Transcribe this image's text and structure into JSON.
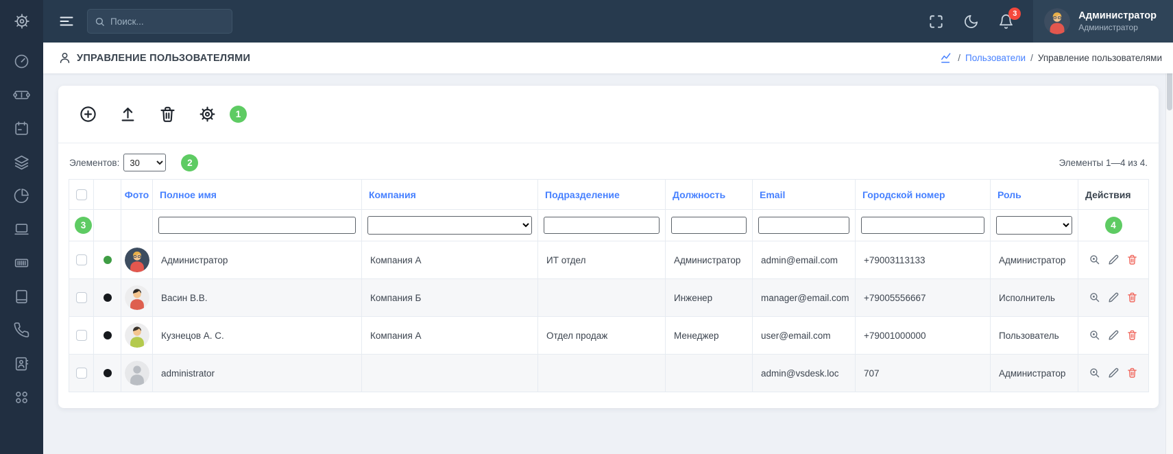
{
  "colors": {
    "accent_blue": "#4680ff",
    "badge_green": "#5ecb63",
    "notification_red": "#f4483c",
    "delete_red": "#f0695f",
    "status_online": "#3f9d44",
    "status_offline": "#16191d"
  },
  "sidebar": {
    "items": [
      "settings",
      "dashboard",
      "tickets",
      "calendar",
      "layers",
      "reports",
      "monitoring",
      "barcode",
      "knowledge-base",
      "telephony",
      "contacts",
      "apps"
    ]
  },
  "topbar": {
    "search_placeholder": "Поиск...",
    "notification_count": "3",
    "user_name": "Администратор",
    "user_role": "Администратор",
    "avatar": {
      "bg": "#3d4d60",
      "skin": "#f4c58f",
      "hair": "#e9b04a",
      "shirt": "#e3574e"
    }
  },
  "page": {
    "title": "УПРАВЛЕНИЕ ПОЛЬЗОВАТЕЛЯМИ",
    "breadcrumb": {
      "sep": "/",
      "link": "Пользователи",
      "current": "Управление пользователями"
    }
  },
  "toolbar": {
    "hint_badge": "1"
  },
  "list_controls": {
    "items_label": "Элементов:",
    "items_per_page": "30",
    "hint_badge": "2",
    "range_text": "Элементы 1—4 из 4."
  },
  "table": {
    "columns": {
      "photo": "Фото",
      "full_name": "Полное имя",
      "company": "Компания",
      "department": "Подразделение",
      "position": "Должность",
      "email": "Email",
      "phone": "Городской номер",
      "role": "Роль",
      "actions": "Действия"
    },
    "filter_hint_badge": "3",
    "actions_hint_badge": "4",
    "rows": [
      {
        "status_color": "#3f9d44",
        "full_name": "Администратор",
        "company": "Компания А",
        "department": "ИТ отдел",
        "position": "Администратор",
        "email": "admin@email.com",
        "phone": "+79003113133",
        "role": "Администратор",
        "avatar": {
          "bg": "#3d4d60",
          "skin": "#f4c58f",
          "hair": "#e9b04a",
          "shirt": "#e3574e"
        }
      },
      {
        "status_color": "#16191d",
        "full_name": "Васин В.В.",
        "company": "Компания Б",
        "department": "",
        "position": "Инженер",
        "email": "manager@email.com",
        "phone": "+79005556667",
        "role": "Исполнитель",
        "avatar": {
          "bg": "#ededee",
          "skin": "#f4c58f",
          "hair": "#2c2823",
          "shirt": "#de5f4f"
        }
      },
      {
        "status_color": "#16191d",
        "full_name": "Кузнецов А. С.",
        "company": "Компания А",
        "department": "Отдел продаж",
        "position": "Менеджер",
        "email": "user@email.com",
        "phone": "+79001000000",
        "role": "Пользователь",
        "avatar": {
          "bg": "#ededee",
          "skin": "#f4c58f",
          "hair": "#3a342c",
          "shirt": "#b4ca4d"
        }
      },
      {
        "status_color": "#16191d",
        "full_name": "administrator",
        "company": "",
        "department": "",
        "position": "",
        "email": "admin@vsdesk.loc",
        "phone": "707",
        "role": "Администратор",
        "avatar": {
          "bg": "#e7e8ea",
          "skin": "#b9bdc3",
          "hair": "transparent",
          "shirt": "#b9bdc3"
        }
      }
    ]
  }
}
